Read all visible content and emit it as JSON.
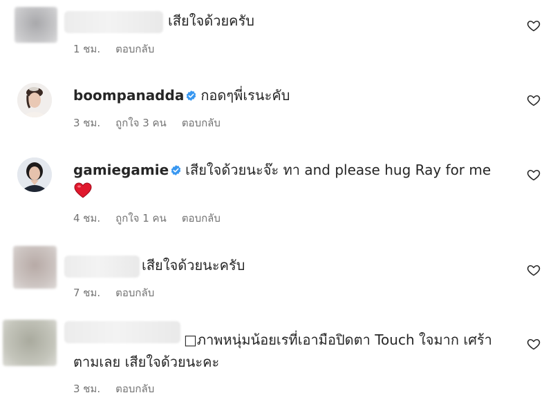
{
  "comments": [
    {
      "username": "",
      "text": "เสียใจด้วยครับ",
      "time": "1 ชม.",
      "likes": "",
      "reply_label": "ตอบกลับ"
    },
    {
      "username": "boompanadda",
      "text": "กอดๆพี่เรนะคับ",
      "time": "3 ชม.",
      "likes": "ถูกใจ 3 คน",
      "reply_label": "ตอบกลับ"
    },
    {
      "username": "gamiegamie",
      "text": "เสียใจด้วยนะจ๊ะ ทา and please hug Ray for me",
      "time": "4 ชม.",
      "likes": "ถูกใจ 1 คน",
      "reply_label": "ตอบกลับ"
    },
    {
      "username": "",
      "text": "เสียใจด้วยนะครับ",
      "time": "7 ชม.",
      "likes": "",
      "reply_label": "ตอบกลับ"
    },
    {
      "username": "",
      "text_line1": "□ภาพหนุ่มน้อยเรที่เอามือปิดตา Touch ใจมาก เศร้า",
      "text_line2": "ตามเลย เสียใจด้วยนะคะ",
      "time": "3 ชม.",
      "likes": "",
      "reply_label": "ตอบกลับ"
    }
  ],
  "icons": {
    "like": "heart-outline-icon",
    "verified": "verified-badge-icon",
    "emoji": "red-heart-emoji"
  },
  "colors": {
    "text": "#262626",
    "meta": "#737373",
    "verified": "#3897f0",
    "emoji_heart": "#e0182d"
  }
}
